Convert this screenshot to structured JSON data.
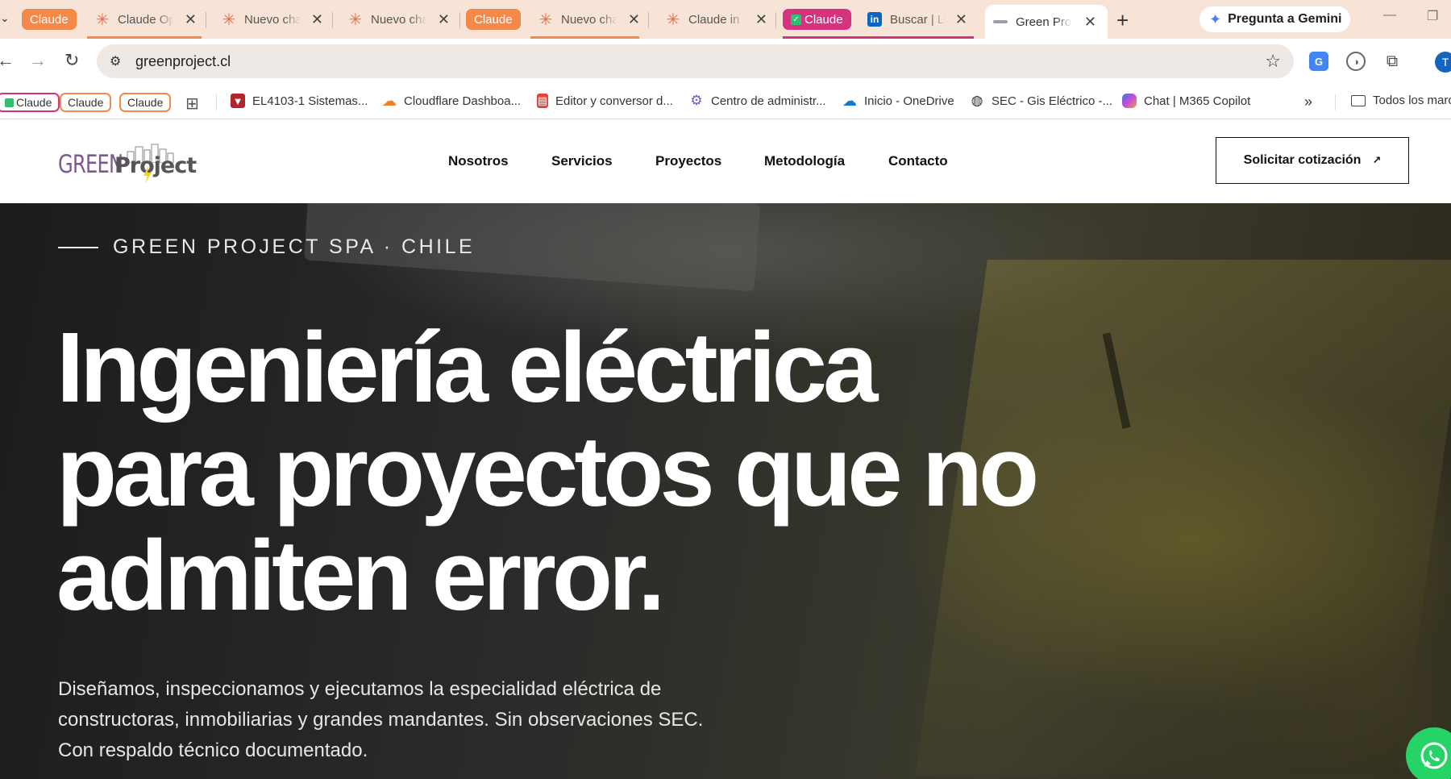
{
  "browser": {
    "tabs": [
      {
        "title": "Claude Op"
      },
      {
        "title": "Nuevo cha"
      },
      {
        "title": "Nuevo cha"
      },
      {
        "title": "Nuevo cha"
      },
      {
        "title": "Claude in C"
      },
      {
        "title": "Buscar | Lin"
      },
      {
        "title": "Green Proj"
      }
    ],
    "groups": [
      "Claude",
      "Claude",
      "Claude"
    ],
    "gemini_label": "Pregunta a Gemini",
    "url": "greenproject.cl",
    "profile_initial": "T",
    "bookmark_groups": [
      "Claude",
      "Claude",
      "Claude"
    ],
    "bookmarks": [
      "EL4103-1 Sistemas...",
      "Cloudflare Dashboa...",
      "Editor y conversor d...",
      "Centro de administr...",
      "Inicio - OneDrive",
      "SEC - Gis Eléctrico -...",
      "Chat | M365 Copilot"
    ],
    "all_bookmarks": "Todos los marc"
  },
  "site": {
    "logo_green": "GREEN",
    "logo_project": "Project",
    "nav": [
      "Nosotros",
      "Servicios",
      "Proyectos",
      "Metodología",
      "Contacto"
    ],
    "cta": "Solicitar cotización",
    "cta_arrow": "↗"
  },
  "hero": {
    "eyebrow": "GREEN PROJECT SPA · CHILE",
    "headline": [
      "Ingeniería eléctrica",
      "para proyectos que no",
      "admiten error."
    ],
    "subtitle": "Diseñamos, inspeccionamos y ejecutamos la especialidad eléctrica de constructoras, inmobiliarias y grandes mandantes. Sin observaciones SEC. Con respaldo técnico documentado."
  },
  "colors": {
    "tabstrip": "#f8e4d6",
    "group_orange": "#f5894a",
    "group_magenta": "#d6337f",
    "whatsapp": "#25d366",
    "logo_green": "#7d5a8c"
  }
}
